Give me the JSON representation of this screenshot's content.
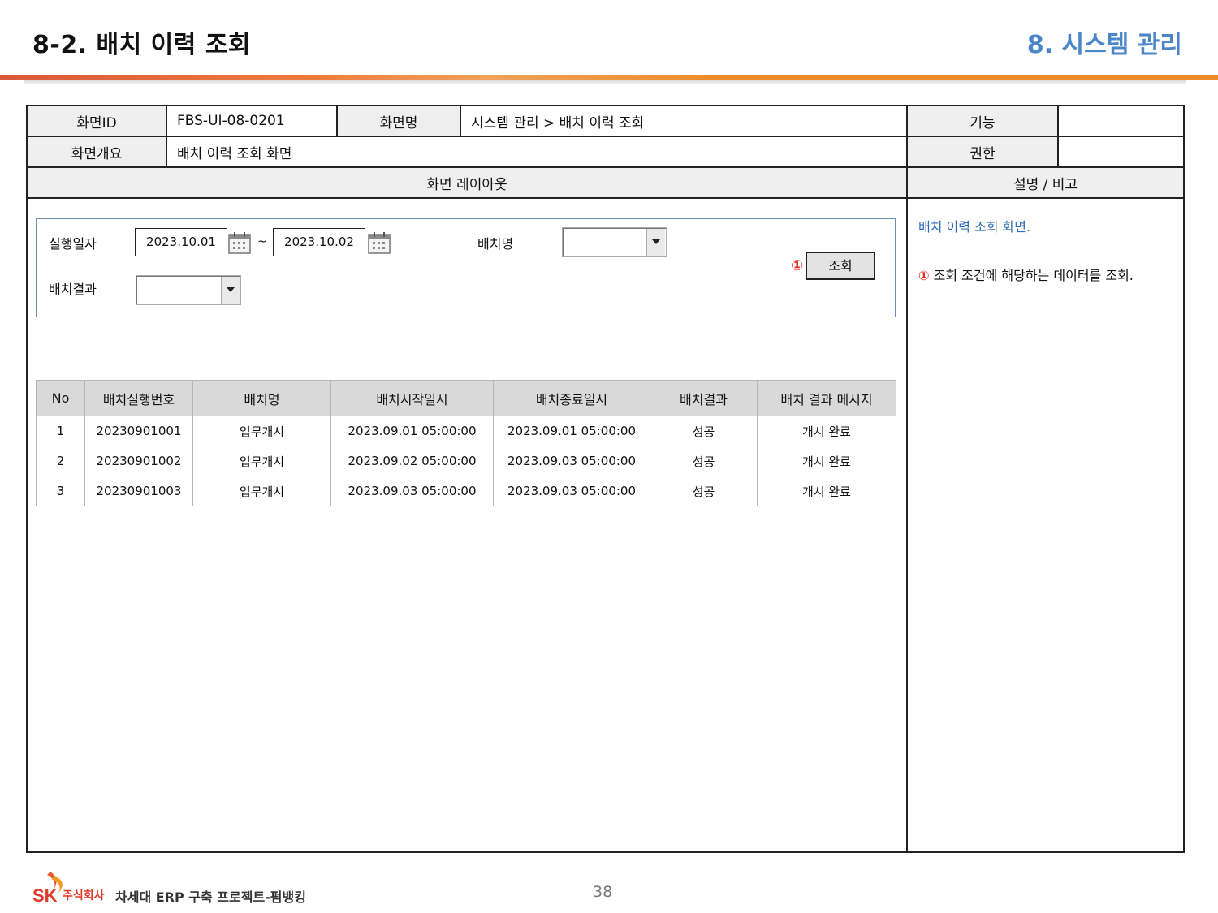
{
  "header": {
    "doc_title": "8-2. 배치 이력 조회",
    "section_title": "8. 시스템 관리"
  },
  "spec": {
    "screen_id_label": "화면ID",
    "screen_id": "FBS-UI-08-0201",
    "screen_name_label": "화면명",
    "screen_name": "시스템 관리 > 배치 이력 조회",
    "function_label": "기능",
    "function_value": "",
    "overview_label": "화면개요",
    "overview": "배치 이력 조회 화면",
    "permission_label": "권한",
    "permission_value": "",
    "layout_label": "화면 레이아웃",
    "notes_label": "설명 / 비고"
  },
  "search": {
    "exec_date_label": "실행일자",
    "date_from": "2023.10.01",
    "tilde": "~",
    "date_to": "2023.10.02",
    "batch_name_label": "배치명",
    "batch_name_value": "",
    "batch_result_label": "배치결과",
    "batch_result_value": "",
    "search_button": "조회",
    "marker": "①"
  },
  "grid": {
    "columns": [
      "No",
      "배치실행번호",
      "배치명",
      "배치시작일시",
      "배치종료일시",
      "배치결과",
      "배치 결과 메시지"
    ],
    "rows": [
      [
        "1",
        "20230901001",
        "업무개시",
        "2023.09.01 05:00:00",
        "2023.09.01 05:00:00",
        "성공",
        "개시 완료"
      ],
      [
        "2",
        "20230901002",
        "업무개시",
        "2023.09.02 05:00:00",
        "2023.09.03 05:00:00",
        "성공",
        "개시 완료"
      ],
      [
        "3",
        "20230901003",
        "업무개시",
        "2023.09.03 05:00:00",
        "2023.09.03 05:00:00",
        "성공",
        "개시 완료"
      ]
    ]
  },
  "notes": {
    "line1": "배치 이력 조회 화면.",
    "line2_marker": "①",
    "line2": "조회 조건에 해당하는 데이터를 조회."
  },
  "footer": {
    "company": "주식회사",
    "project": "차세대 ERP 구축 프로젝트-펌뱅킹",
    "page": "38"
  },
  "colors": {
    "section_title": "#4a86c8",
    "accent_orange": "#ee8a27",
    "marker_red": "#e03020",
    "note_blue": "#2e6eb7"
  }
}
